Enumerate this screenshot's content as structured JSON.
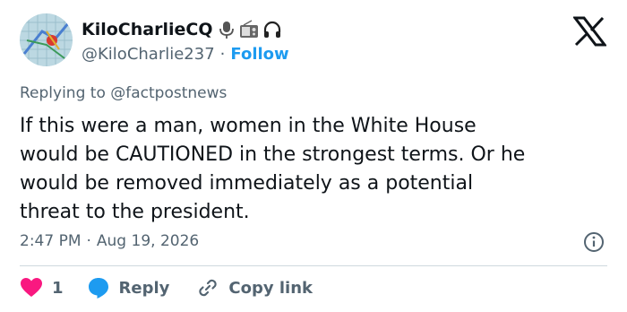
{
  "user": {
    "display_name": "KiloCharlieCQ",
    "handle": "@KiloCharlie237",
    "separator": "·",
    "follow_label": "Follow",
    "badge_icons": [
      "microphone-icon",
      "radio-icon",
      "headphones-icon"
    ]
  },
  "tweet": {
    "replying_to": "Replying to @factpostnews",
    "text": "If this were a man, women in the White House\nwould be CAUTIONED in the strongest terms. Or he\nwould be removed immediately as a potential\nthreat to the president.",
    "time": "2:47 PM",
    "date_separator": "·",
    "date": "Aug 19, 2026"
  },
  "actions": {
    "like_count": "1",
    "reply_label": "Reply",
    "copy_link_label": "Copy link"
  },
  "colors": {
    "follow": "#1d9bf0",
    "like_heart": "#f91880",
    "reply_bubble": "#1d9bf0",
    "secondary_text": "#536471"
  }
}
